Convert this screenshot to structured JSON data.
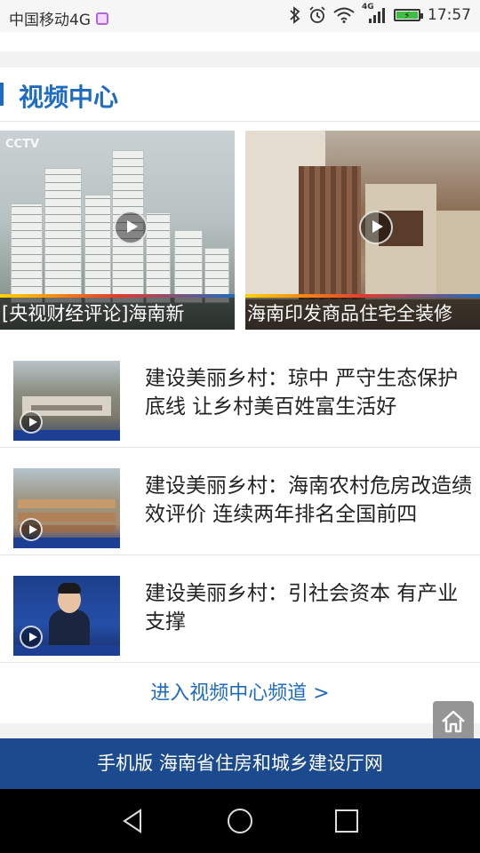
{
  "status_bar": {
    "carrier": "中国移动4G",
    "network_badge": "4G",
    "time": "17:57",
    "icons": [
      "bluetooth-icon",
      "alarm-icon",
      "wifi-icon",
      "signal-icon",
      "battery-icon"
    ]
  },
  "section": {
    "title": "视频中心",
    "accent_color": "#1e6bbf"
  },
  "featured": [
    {
      "caption": "[央视财经评论]海南新",
      "logo": "CCTV"
    },
    {
      "caption": "海南印发商品住宅全装修",
      "logo": ""
    }
  ],
  "list": [
    {
      "title": "建设美丽乡村：琼中 严守生态保护底线 让乡村美百姓富生活好"
    },
    {
      "title": "建设美丽乡村：海南农村危房改造绩效评价 连续两年排名全国前四"
    },
    {
      "title": "建设美丽乡村：引社会资本 有产业支撑"
    }
  ],
  "more_link": "进入视频中心频道 >",
  "footer": "手机版 海南省住房和城乡建设厅网",
  "colors": {
    "footer_bg": "#1b4a8e",
    "link": "#1e6bbf"
  }
}
